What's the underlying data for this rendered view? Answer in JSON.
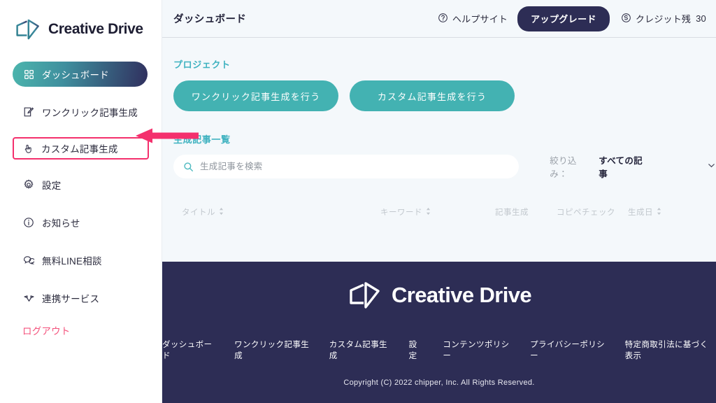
{
  "brand": {
    "name": "Creative Drive",
    "logo_icon": "creative-drive-logo-icon"
  },
  "sidebar": {
    "items": [
      {
        "label": "ダッシュボード",
        "icon": "grid-dashboard-icon",
        "active": true
      },
      {
        "label": "ワンクリック記事生成",
        "icon": "edit-square-icon",
        "active": false
      },
      {
        "label": "カスタム記事生成",
        "icon": "hand-pointer-icon",
        "active": false,
        "highlighted": true
      },
      {
        "label": "設定",
        "icon": "gear-icon",
        "active": false
      },
      {
        "label": "お知らせ",
        "icon": "info-circle-icon",
        "active": false
      },
      {
        "label": "無料LINE相談",
        "icon": "chat-bubbles-icon",
        "active": false
      },
      {
        "label": "連携サービス",
        "icon": "link-services-icon",
        "active": false
      }
    ],
    "logout_label": "ログアウト"
  },
  "annotation": {
    "arrow_icon": "left-arrow-annotation-icon",
    "arrow_color": "#f4306d",
    "highlight_color": "#f4306d"
  },
  "header": {
    "page_title": "ダッシュボード",
    "help_icon": "question-circle-icon",
    "help_label": "ヘルプサイト",
    "upgrade_label": "アップグレード",
    "credit_icon": "coin-s-icon",
    "credit_label": "クレジット残",
    "credit_value": "30"
  },
  "project": {
    "section_label": "プロジェクト",
    "buttons": [
      {
        "label": "ワンクリック記事生成を行う"
      },
      {
        "label": "カスタム記事生成を行う"
      }
    ]
  },
  "articles": {
    "section_label": "生成記事一覧",
    "search": {
      "icon": "search-icon",
      "placeholder": "生成記事を検索",
      "value": ""
    },
    "filter": {
      "label": "絞り込み：",
      "selected": "すべての記事",
      "chevron_icon": "chevron-down-icon"
    },
    "columns": [
      {
        "label": "タイトル",
        "sortable": true
      },
      {
        "label": "キーワード",
        "sortable": true
      },
      {
        "label": "記事生成",
        "sortable": false
      },
      {
        "label": "コピペチェック",
        "sortable": false
      },
      {
        "label": "生成日",
        "sortable": true
      }
    ],
    "rows": []
  },
  "footer": {
    "brand_name": "Creative Drive",
    "logo_icon": "creative-drive-logo-icon",
    "links": [
      "ダッシュボード",
      "ワンクリック記事生成",
      "カスタム記事生成",
      "設定",
      "コンテンツポリシー",
      "プライバシーポリシー",
      "特定商取引法に基づく表示"
    ],
    "copyright": "Copyright (C) 2022 chipper, Inc. All Rights Reserved."
  },
  "colors": {
    "teal": "#43b2b2",
    "navy": "#2d2d55",
    "accent_pink": "#f4306d",
    "logout_pink": "#f4527c",
    "page_bg": "#f4f8fb",
    "section_label": "#3fb2c0"
  }
}
